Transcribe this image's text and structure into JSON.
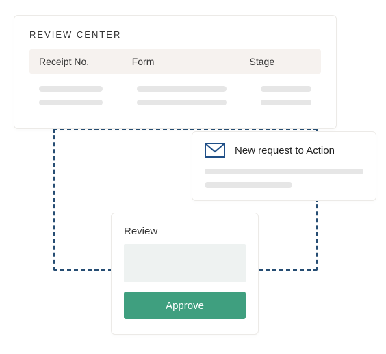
{
  "reviewCenter": {
    "title": "REVIEW CENTER",
    "columns": {
      "c1": "Receipt No.",
      "c2": "Form",
      "c3": "Stage"
    }
  },
  "notification": {
    "title": "New request to Action"
  },
  "approve": {
    "title": "Review",
    "button": "Approve"
  }
}
